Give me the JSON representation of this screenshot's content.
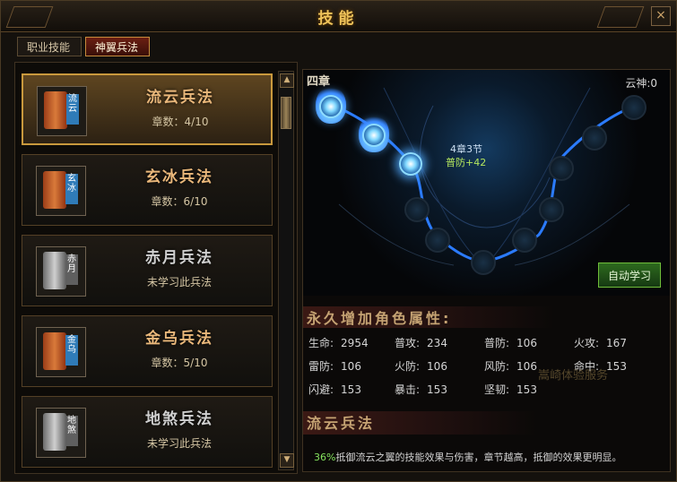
{
  "window": {
    "title": "技能",
    "close_symbol": "×"
  },
  "tabs": [
    {
      "label": "职业技能",
      "active": false
    },
    {
      "label": "神翼兵法",
      "active": true
    }
  ],
  "skill_list": [
    {
      "name": "流云兵法",
      "subtitle": "章数：4/10",
      "badge": "流云",
      "learned": true,
      "selected": true
    },
    {
      "name": "玄冰兵法",
      "subtitle": "章数：6/10",
      "badge": "玄冰",
      "learned": true,
      "selected": false
    },
    {
      "name": "赤月兵法",
      "subtitle": "未学习此兵法",
      "badge": "赤月",
      "learned": false,
      "selected": false
    },
    {
      "name": "金乌兵法",
      "subtitle": "章数：5/10",
      "badge": "金乌",
      "learned": true,
      "selected": false
    },
    {
      "name": "地煞兵法",
      "subtitle": "未学习此兵法",
      "badge": "地煞",
      "learned": false,
      "selected": false
    }
  ],
  "scrollbar": {
    "up": "▲",
    "down": "▼"
  },
  "detail": {
    "chapter": "四章",
    "yunshen": "云神:0",
    "tooltip": {
      "section": "4章3节",
      "bonus": "普防+42"
    },
    "auto_learn_button": "自动学习",
    "attributes_title": "永久增加角色属性:",
    "stats": [
      [
        {
          "label": "生命:",
          "value": "2954"
        },
        {
          "label": "普攻:",
          "value": "234"
        },
        {
          "label": "普防:",
          "value": "106"
        },
        {
          "label": "火攻:",
          "value": "167"
        }
      ],
      [
        {
          "label": "雷防:",
          "value": "106"
        },
        {
          "label": "火防:",
          "value": "106"
        },
        {
          "label": "风防:",
          "value": "106"
        },
        {
          "label": "命中:",
          "value": "153"
        }
      ],
      [
        {
          "label": "闪避:",
          "value": "153"
        },
        {
          "label": "暴击:",
          "value": "153"
        },
        {
          "label": "坚韧:",
          "value": "153"
        }
      ]
    ],
    "watermark": "嵩崎体验服务",
    "skill_title": "流云兵法",
    "description": {
      "percent": "36%",
      "text": "抵御流云之翼的技能效果与伤害，章节越高，抵御的效果更明显。"
    }
  },
  "colors": {
    "accent_gold": "#f0c45b",
    "active_tab": "#6b1f12",
    "lit_node": "#80d8ff",
    "button_green": "#2d6a1e",
    "description_percent": "#86e45f"
  }
}
